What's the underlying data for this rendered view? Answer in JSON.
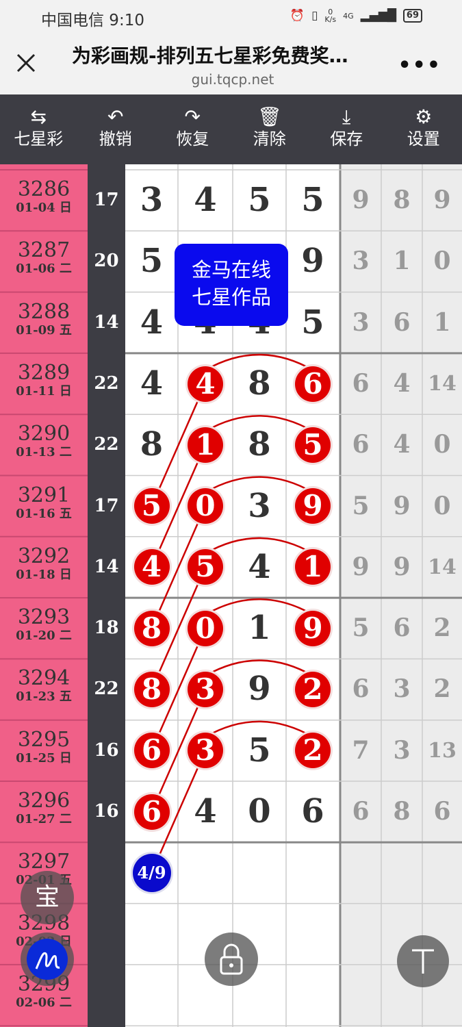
{
  "status": {
    "carrier_time": "中国电信 9:10",
    "net_speed": "0\nK/s",
    "signal": "4G",
    "battery": "69"
  },
  "browser": {
    "title": "为彩画规-排列五七星彩免费奖…",
    "url": "gui.tqcp.net",
    "close_icon": "close-icon",
    "more": "•••"
  },
  "toolbar": [
    {
      "label": "七星彩",
      "icon": "swap-icon",
      "glyph": "⇆"
    },
    {
      "label": "撤销",
      "icon": "undo-icon",
      "glyph": "↶"
    },
    {
      "label": "恢复",
      "icon": "redo-icon",
      "glyph": "↷"
    },
    {
      "label": "清除",
      "icon": "trash-icon",
      "glyph": "🗑"
    },
    {
      "label": "保存",
      "icon": "download-icon",
      "glyph": "⤓"
    },
    {
      "label": "设置",
      "icon": "gear-icon",
      "glyph": "⚙"
    }
  ],
  "watermark": {
    "line1": "金马在线",
    "line2": "七星作品"
  },
  "rows": [
    {
      "issue": "3286",
      "date": "01-04 日",
      "sum": "17",
      "main": [
        "3",
        "4",
        "5",
        "5"
      ],
      "side": [
        "9",
        "8",
        "9"
      ]
    },
    {
      "issue": "3287",
      "date": "01-06 二",
      "sum": "20",
      "main": [
        "5",
        "",
        "",
        "9"
      ],
      "side": [
        "3",
        "1",
        "0"
      ]
    },
    {
      "issue": "3288",
      "date": "01-09 五",
      "sum": "14",
      "main": [
        "4",
        "4",
        "4",
        "5"
      ],
      "side": [
        "3",
        "6",
        "1"
      ]
    },
    {
      "issue": "3289",
      "date": "01-11 日",
      "sum": "22",
      "main": [
        "4",
        "4",
        "8",
        "6"
      ],
      "side": [
        "6",
        "4",
        "14"
      ]
    },
    {
      "issue": "3290",
      "date": "01-13 二",
      "sum": "22",
      "main": [
        "8",
        "1",
        "8",
        "5"
      ],
      "side": [
        "6",
        "4",
        "0"
      ]
    },
    {
      "issue": "3291",
      "date": "01-16 五",
      "sum": "17",
      "main": [
        "5",
        "0",
        "3",
        "9"
      ],
      "side": [
        "5",
        "9",
        "0"
      ]
    },
    {
      "issue": "3292",
      "date": "01-18 日",
      "sum": "14",
      "main": [
        "4",
        "5",
        "4",
        "1"
      ],
      "side": [
        "9",
        "9",
        "14"
      ]
    },
    {
      "issue": "3293",
      "date": "01-20 二",
      "sum": "18",
      "main": [
        "8",
        "0",
        "1",
        "9"
      ],
      "side": [
        "5",
        "6",
        "2"
      ]
    },
    {
      "issue": "3294",
      "date": "01-23 五",
      "sum": "22",
      "main": [
        "8",
        "3",
        "9",
        "2"
      ],
      "side": [
        "6",
        "3",
        "2"
      ]
    },
    {
      "issue": "3295",
      "date": "01-25 日",
      "sum": "16",
      "main": [
        "6",
        "3",
        "5",
        "2"
      ],
      "side": [
        "7",
        "3",
        "13"
      ]
    },
    {
      "issue": "3296",
      "date": "01-27 二",
      "sum": "16",
      "main": [
        "6",
        "4",
        "0",
        "6"
      ],
      "side": [
        "6",
        "8",
        "6"
      ]
    },
    {
      "issue": "3297",
      "date": "02-01 五",
      "sum": "",
      "main": [
        "",
        "",
        "",
        ""
      ],
      "side": [
        "",
        "",
        ""
      ]
    },
    {
      "issue": "3298",
      "date": "02-03 日",
      "sum": "",
      "main": [
        "",
        "",
        "",
        ""
      ],
      "side": [
        "",
        "",
        ""
      ]
    },
    {
      "issue": "3299",
      "date": "02-06 二",
      "sum": "",
      "main": [
        "",
        "",
        "",
        ""
      ],
      "side": [
        "",
        "",
        ""
      ]
    }
  ],
  "balls": [
    {
      "r": 3,
      "c": 1
    },
    {
      "r": 3,
      "c": 3
    },
    {
      "r": 4,
      "c": 1
    },
    {
      "r": 4,
      "c": 3
    },
    {
      "r": 5,
      "c": 0
    },
    {
      "r": 5,
      "c": 1
    },
    {
      "r": 5,
      "c": 3
    },
    {
      "r": 6,
      "c": 0
    },
    {
      "r": 6,
      "c": 1
    },
    {
      "r": 6,
      "c": 3
    },
    {
      "r": 7,
      "c": 0
    },
    {
      "r": 7,
      "c": 1
    },
    {
      "r": 7,
      "c": 3
    },
    {
      "r": 8,
      "c": 0
    },
    {
      "r": 8,
      "c": 1
    },
    {
      "r": 8,
      "c": 3
    },
    {
      "r": 9,
      "c": 0
    },
    {
      "r": 9,
      "c": 1
    },
    {
      "r": 9,
      "c": 3
    },
    {
      "r": 10,
      "c": 0
    }
  ],
  "counter": "4/9",
  "float": {
    "bao": "宝",
    "lock_icon": "lock-icon",
    "top_icon": "top-icon",
    "pen_icon": "pen-icon"
  },
  "colors": {
    "ball": "#e00000",
    "date_col": "#f06088",
    "dark": "#3d3d44",
    "watermark": "#0a0aee",
    "counter": "#0a0acc"
  }
}
